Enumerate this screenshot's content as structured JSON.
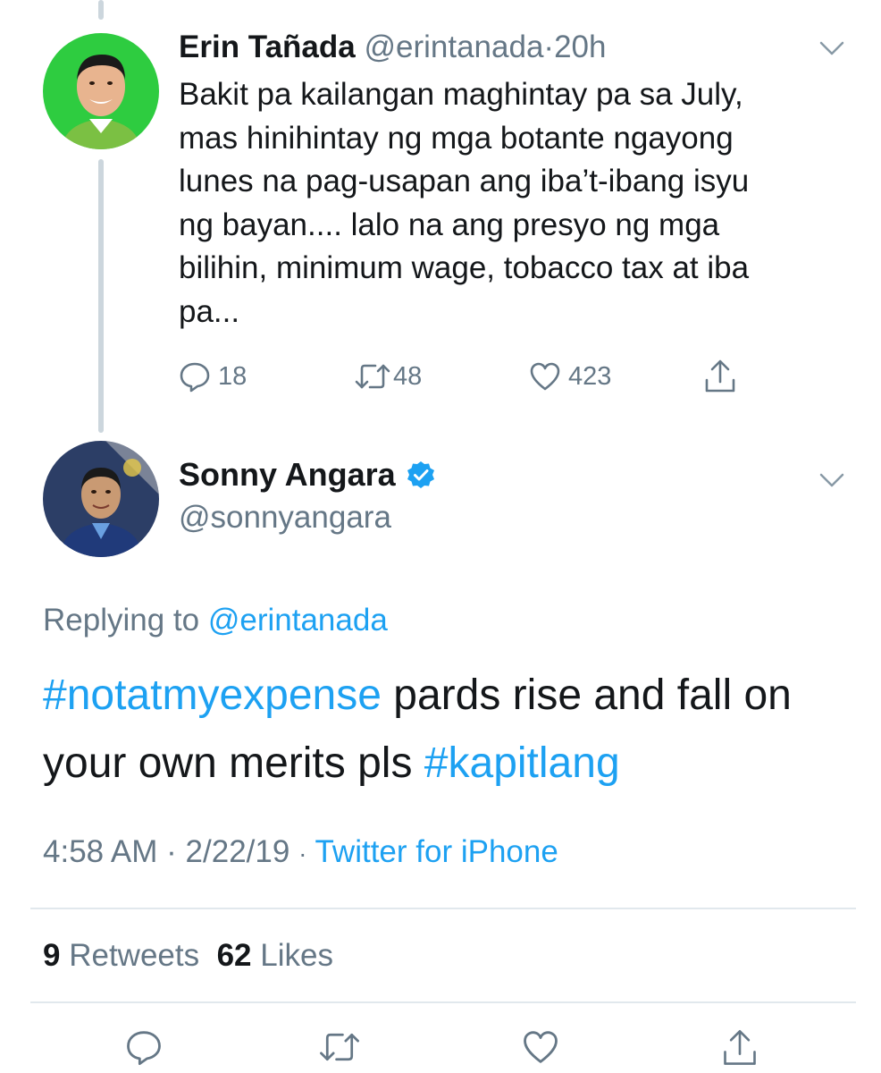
{
  "parent_tweet": {
    "author_name": "Erin Tañada",
    "handle": "@erintanada",
    "separator": "·",
    "time_ago": "20h",
    "text_lines": [
      "Bakit pa kailangan maghintay pa sa July,",
      "mas hinihintay ng mga botante ngayong",
      "lunes na pag-usapan ang iba’t-ibang isyu",
      "ng bayan.... lalo na ang presyo ng mga",
      "bilihin, minimum wage, tobacco tax at iba",
      "pa..."
    ],
    "reply_count": "18",
    "retweet_count": "48",
    "like_count": "423",
    "avatar_bg": "#2ecc40"
  },
  "main_tweet": {
    "author_name": "Sonny Angara",
    "verified": true,
    "handle": "@sonnyangara",
    "replying_prefix": "Replying to",
    "replying_to": "@erintanada",
    "hashtag_1": "#notatmyexpense",
    "text_middle": " pards rise and fall on your own merits pls ",
    "hashtag_2": "#kapitlang",
    "time": "4:58 AM",
    "date": "2/22/19",
    "separator": "·",
    "source": "Twitter for iPhone",
    "retweets_count": "9",
    "retweets_label": "Retweets",
    "likes_count": "62",
    "likes_label": "Likes"
  },
  "icons": {
    "reply": "reply-icon",
    "retweet": "retweet-icon",
    "like": "heart-icon",
    "share": "share-icon",
    "more": "chevron-down-icon",
    "verified": "verified-badge-icon"
  },
  "colors": {
    "link": "#1da1f2",
    "secondary_text": "#657786",
    "primary_text": "#14171a",
    "thread_line": "#ccd6dd"
  }
}
